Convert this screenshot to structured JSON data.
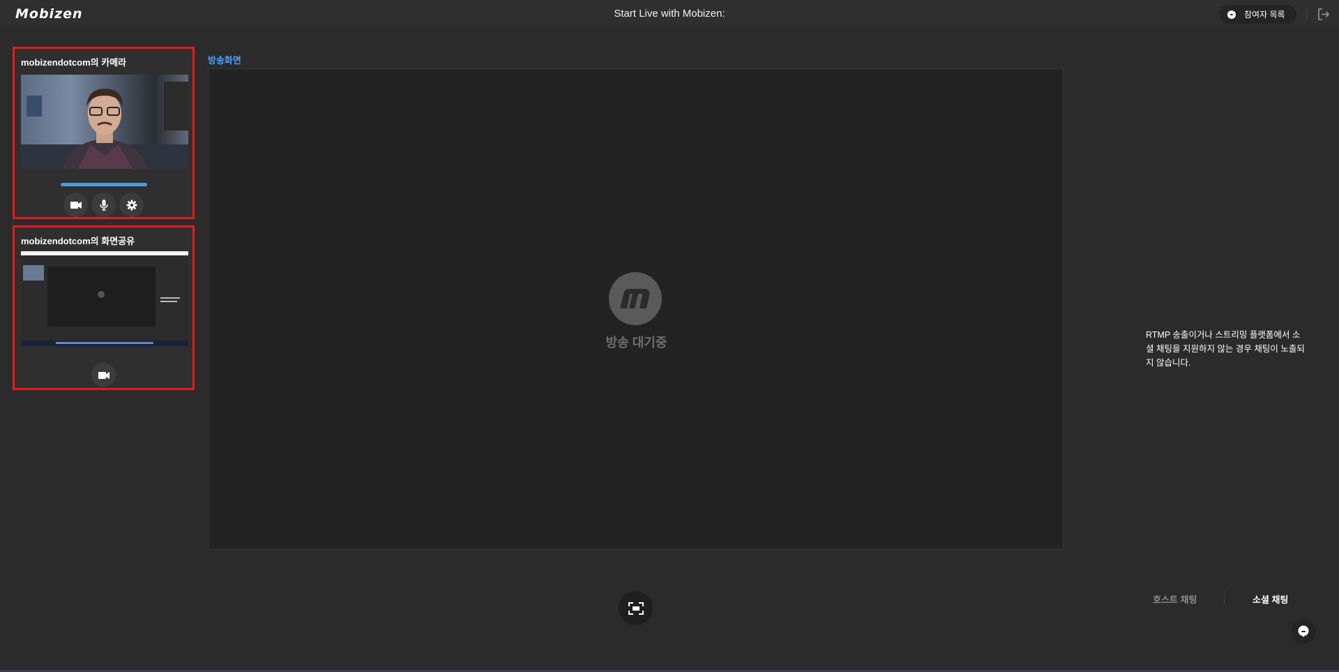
{
  "header": {
    "logo": "Mobizen",
    "title": "Start Live with Mobizen:",
    "participants_label": "참여자 목록",
    "icons": {
      "participants": "chat-bubble-icon",
      "exit": "exit-icon"
    }
  },
  "sources": {
    "camera": {
      "title": "mobizendotcom의 카메라",
      "mic_level": 1.0,
      "controls": [
        "video-camera-icon",
        "microphone-icon",
        "gear-icon"
      ]
    },
    "screen_share": {
      "title": "mobizendotcom의 화면공유",
      "controls": [
        "video-camera-icon"
      ]
    }
  },
  "stage": {
    "label": "방송화면",
    "status": "방송 대기중",
    "logo_letter": "m"
  },
  "chat": {
    "notice": "RTMP 송출이거나 스트리밍 플랫폼에서 소셜 채팅을 지원하지 않는 경우 채팅이 노출되지 않습니다.",
    "tabs": {
      "host": "호스트 채팅",
      "social": "소셜 채팅"
    },
    "active_tab": "social"
  },
  "colors": {
    "accent": "#4aa3ff",
    "highlight_border": "#e8191f",
    "background": "#2b2b2b"
  }
}
